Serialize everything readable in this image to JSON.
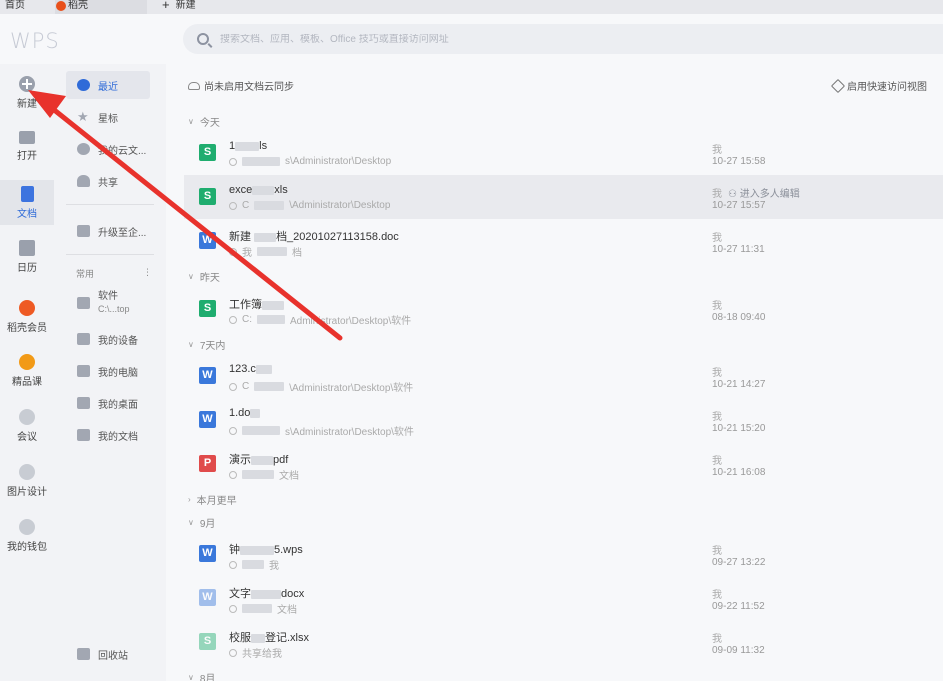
{
  "tabs": {
    "home": "首页",
    "daoke": "稻壳",
    "new": "新建"
  },
  "header": {
    "logo": "WPS",
    "search_placeholder": "搜索文档、应用、模板、Office 技巧或直接访问网址"
  },
  "rail": [
    {
      "label": "新建",
      "icon": "plus-circle-icon"
    },
    {
      "label": "打开",
      "icon": "folder-icon"
    },
    {
      "label": "文档",
      "icon": "document-icon",
      "active": true
    },
    {
      "label": "日历",
      "icon": "calendar-icon"
    },
    {
      "label": "稻壳会员",
      "icon": "daoke-icon"
    },
    {
      "label": "精品课",
      "icon": "course-icon"
    },
    {
      "label": "会议",
      "icon": "meeting-icon"
    },
    {
      "label": "图片设计",
      "icon": "image-design-icon"
    },
    {
      "label": "我的钱包",
      "icon": "wallet-icon"
    }
  ],
  "sidebar": {
    "items": [
      {
        "label": "最近",
        "active": true
      },
      {
        "label": "星标"
      },
      {
        "label": "我的云文..."
      },
      {
        "label": "共享"
      },
      {
        "label": "升级至企..."
      }
    ],
    "section": "常用",
    "common": [
      {
        "label": "软件",
        "sub": "C:\\...top"
      },
      {
        "label": "我的设备"
      },
      {
        "label": "我的电脑"
      },
      {
        "label": "我的桌面"
      },
      {
        "label": "我的文档"
      }
    ],
    "recycle": "回收站"
  },
  "main": {
    "sync": "尚未启用文档云同步",
    "quickview": "启用快速访问视图",
    "groups": {
      "today": "今天",
      "yesterday": "昨天",
      "week": "7天内",
      "month": "本月更早",
      "sep": "9月",
      "aug": "8月"
    },
    "files": [
      {
        "type": "s",
        "name_a": "1",
        "name_b": "ls",
        "path_b": "s\\Administrator\\Desktop",
        "owner": "我",
        "time": "10-27 15:58"
      },
      {
        "type": "s",
        "name_a": "exce",
        "name_b": "xls",
        "path_a": "C",
        "path_b": "\\Administrator\\Desktop",
        "owner": "我",
        "collab": "进入多人编辑",
        "time": "10-27 15:57"
      },
      {
        "type": "w",
        "name_a": "新建 ",
        "name_b": "档_20201027113158.doc",
        "path_a": "我",
        "path_b": "档",
        "owner": "我",
        "time": "10-27 11:31"
      },
      {
        "type": "s",
        "name_a": "工作簿",
        "name_b": "",
        "path_a": "C:",
        "path_b": "Administrator\\Desktop\\软件",
        "owner": "我",
        "time": "08-18 09:40"
      },
      {
        "type": "w",
        "name_a": "123.c",
        "name_b": "",
        "path_a": "C",
        "path_b": "\\Administrator\\Desktop\\软件",
        "owner": "我",
        "time": "10-21 14:27"
      },
      {
        "type": "w",
        "name_a": "1.do",
        "name_b": "",
        "path_b": "s\\Administrator\\Desktop\\软件",
        "owner": "我",
        "time": "10-21 15:20"
      },
      {
        "type": "p",
        "name_a": "演示",
        "name_b": "pdf",
        "path_b": "文档",
        "owner": "我",
        "time": "10-21 16:08"
      },
      {
        "type": "w",
        "name_a": "钟",
        "name_b": "5.wps",
        "path_b": "我",
        "owner": "我",
        "time": "09-27 13:22"
      },
      {
        "type": "w",
        "light": true,
        "name_a": "文字",
        "name_b": "docx",
        "path_b": "文档",
        "owner": "我",
        "time": "09-22 11:52"
      },
      {
        "type": "s",
        "light": true,
        "name_a": "校服",
        "name_b": "登记.xlsx",
        "path_a": "共享给我",
        "path_b": "",
        "owner": "我",
        "time": "09-09 11:32"
      }
    ]
  },
  "colors": {
    "accent": "#2f6bd8",
    "arrow": "#e8322c",
    "sheet": "#1fad6f",
    "writer": "#3a78db",
    "pdf": "#e04b4b"
  }
}
